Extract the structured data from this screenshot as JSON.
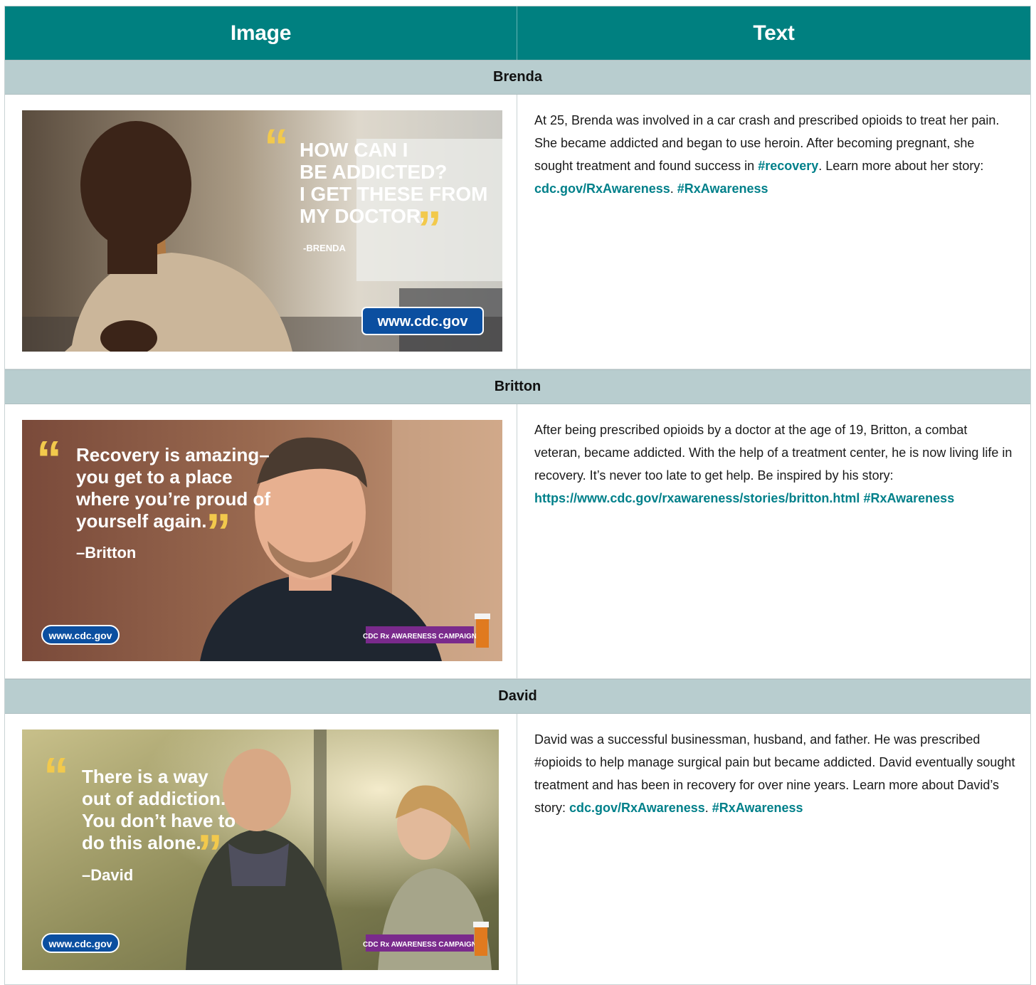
{
  "header": {
    "col_image": "Image",
    "col_text": "Text"
  },
  "rows": [
    {
      "name": "Brenda",
      "image": {
        "quote_lines": [
          "HOW CAN I",
          "BE ADDICTED?",
          "I GET THESE FROM",
          "MY DOCTOR."
        ],
        "attribution": "-BRENDA",
        "url_badge": "www.cdc.gov"
      },
      "text": {
        "p1": "At 25, Brenda was involved in a car crash and prescribed opioids to treat her pain. She became addicted and began to use heroin. After becoming pregnant, she sought treatment and found success in ",
        "link1": "#recovery",
        "p2": ". Learn more about her story: ",
        "link2": "cdc.gov/RxAwareness",
        "p3": ". ",
        "link3": "#RxAwareness"
      }
    },
    {
      "name": "Britton",
      "image": {
        "quote_lines": [
          "Recovery is amazing–",
          "you get to a place",
          "where you’re proud of",
          "yourself again."
        ],
        "attribution": "–Britton",
        "url_badge": "www.cdc.gov",
        "campaign_badge": "CDC Rx AWARENESS CAMPAIGN"
      },
      "text": {
        "p1": "After being prescribed opioids by a doctor at the age of 19, Britton, a combat veteran, became addicted. With the help of a treatment center, he is now living life in recovery. It’s never too late to get help. Be inspired by his story: ",
        "link1": "https://www.cdc.gov/rxawareness/stories/britton.html",
        "p2": " ",
        "link2": "#RxAwareness"
      }
    },
    {
      "name": "David",
      "image": {
        "quote_lines": [
          "There is a way",
          "out of addiction.",
          "You don’t have to",
          "do this alone."
        ],
        "attribution": "–David",
        "url_badge": "www.cdc.gov",
        "campaign_badge": "CDC Rx AWARENESS CAMPAIGN"
      },
      "text": {
        "p1": "David was a successful businessman, husband, and father. He was prescribed #opioids to help manage surgical pain but became addicted. David eventually sought treatment and has been in recovery for over nine years. Learn more about David’s story: ",
        "link1": "cdc.gov/RxAwareness",
        "p2": ". ",
        "link2": "#RxAwareness"
      }
    }
  ],
  "colors": {
    "header_bg": "#008080",
    "group_bg": "#b8cdcf",
    "link": "#00808a",
    "quote_mark": "#f2c94c",
    "badge_blue": "#0b4fa0",
    "badge_purple": "#7a2a8c"
  }
}
